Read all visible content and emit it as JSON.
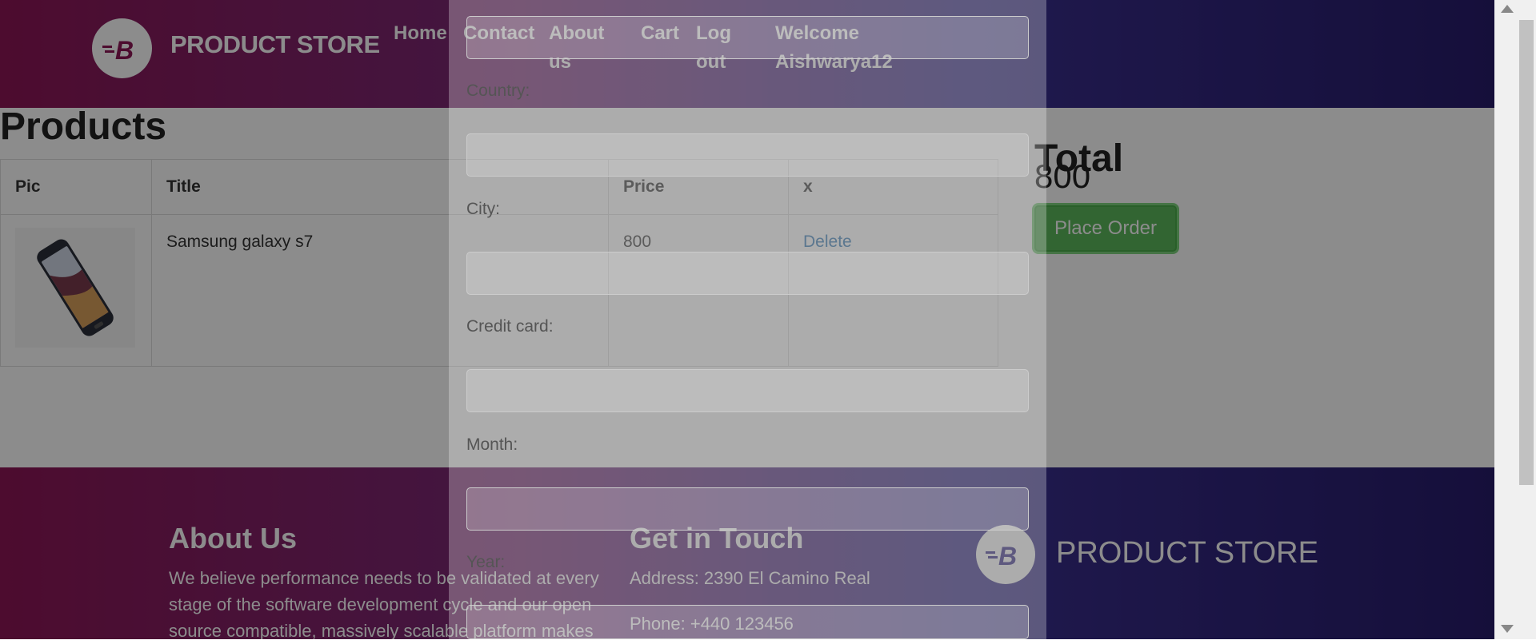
{
  "header": {
    "brand": "PRODUCT STORE",
    "nav": {
      "home": "Home",
      "contact": "Contact",
      "about": "About us",
      "cart": "Cart",
      "logout": "Log out",
      "welcome": "Welcome Aishwarya12"
    }
  },
  "products": {
    "title": "Products",
    "columns": [
      "Pic",
      "Title",
      "Price",
      "x"
    ],
    "rows": [
      {
        "title": "Samsung galaxy s7",
        "price": "800",
        "action": "Delete"
      }
    ]
  },
  "total": {
    "title": "Total",
    "value": "800",
    "button": "Place Order"
  },
  "modal_form": {
    "labels": [
      "Country:",
      "City:",
      "Credit card:",
      "Month:",
      "Year:"
    ]
  },
  "footer": {
    "about_title": "About Us",
    "about_text": "We believe performance needs to be validated at every stage of the software development cycle and our open source compatible, massively scalable platform makes",
    "contact_title": "Get in Touch",
    "address": "Address: 2390 El Camino Real",
    "phone": "Phone: +440 123456",
    "brand": "PRODUCT STORE"
  },
  "colors": {
    "accent": "#8c1656",
    "accent_dark": "#271c6b",
    "order_button": "#5cb85c",
    "link": "#337ab7"
  },
  "icons": [
    "brand-logo-icon",
    "phone-product-image"
  ]
}
